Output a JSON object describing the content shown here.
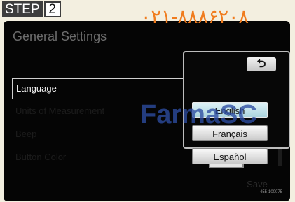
{
  "step": {
    "word": "STEP",
    "number": "2"
  },
  "screen": {
    "title": "General Settings"
  },
  "settings": {
    "rows": [
      {
        "label": "",
        "state": "faded"
      },
      {
        "label": "Language",
        "state": "active"
      },
      {
        "label": "Units of Measurement",
        "state": "faded"
      },
      {
        "label": "Beep",
        "state": "faded"
      },
      {
        "label": "Button Color",
        "state": "faded"
      }
    ],
    "save_label": "Save"
  },
  "language_popup": {
    "back_icon": "return-arrow-icon",
    "options": [
      {
        "label": "English",
        "selected": true
      },
      {
        "label": "Français",
        "selected": false
      },
      {
        "label": "Español",
        "selected": false
      }
    ]
  },
  "watermarks": {
    "digits": "۰۲۱-۸۸۸۶۲۰۸",
    "text": "FarmaSC"
  },
  "colors": {
    "accent_selected": "#a9d3dd",
    "watermark_orange": "#f07c1e",
    "watermark_blue": "#2d4da2"
  },
  "image_credit": "455-100075"
}
